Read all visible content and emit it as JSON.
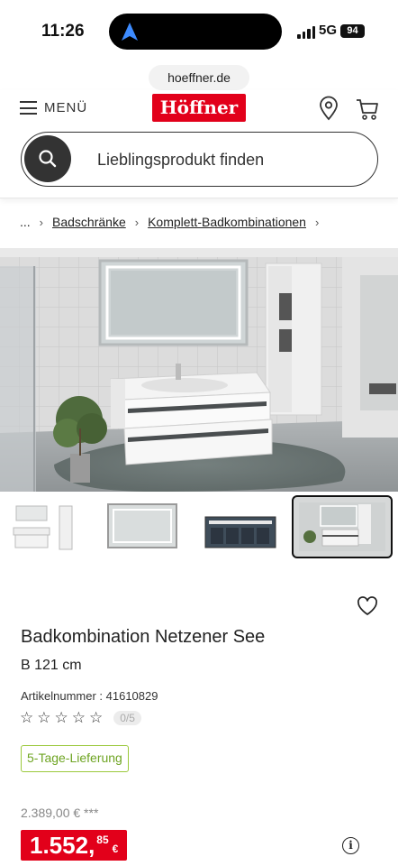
{
  "status_bar": {
    "time": "11:26",
    "network": "5G",
    "battery": "94"
  },
  "browser": {
    "url": "hoeffner.de"
  },
  "header": {
    "menu_label": "MENÜ",
    "logo_text": "Höffner",
    "search_placeholder": "Lieblingsprodukt finden",
    "brand_color": "#e2001a"
  },
  "breadcrumb": {
    "ellipsis": "...",
    "items": [
      "Badschränke",
      "Komplett-Badkombinationen"
    ]
  },
  "gallery": {
    "thumbnails": [
      "cabinet-set",
      "led-mirror",
      "vanity-drawers-top",
      "bathroom-scene"
    ],
    "active_index": 3
  },
  "product": {
    "title": "Badkombination Netzener See",
    "width": "B 121 cm",
    "article_number": "Artikelnummer : 41610829",
    "rating_badge": "0/5",
    "rating_stars": 0,
    "delivery_badge": "5-Tage-Lieferung",
    "old_price": "2.389,00 € ***",
    "price_main": "1.552,",
    "price_cents": "85",
    "price_currency": "€"
  },
  "icons": {
    "menu": "hamburger-icon",
    "location": "location-pin-icon",
    "cart": "cart-icon",
    "search": "search-icon",
    "favorite": "heart-icon",
    "info": "info-icon"
  }
}
